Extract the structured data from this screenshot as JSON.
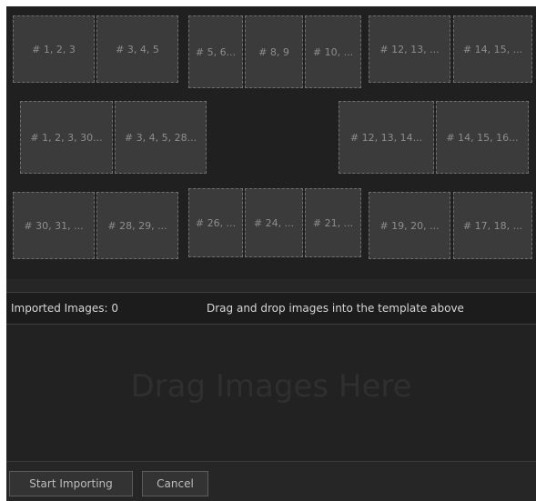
{
  "template": {
    "row1": [
      "# 1, 2, 3",
      "# 3, 4, 5",
      "# 5, 6...",
      "# 8, 9",
      "# 10, ...",
      "# 12, 13, ...",
      "# 14, 15, ..."
    ],
    "row2": [
      "# 1, 2, 3, 30...",
      "# 3, 4, 5, 28...",
      "# 12, 13, 14...",
      "# 14, 15, 16..."
    ],
    "row3": [
      "# 30, 31, ...",
      "# 28, 29, ...",
      "# 26, ...",
      "# 24, ...",
      "# 21, ...",
      "# 19, 20, ...",
      "# 17, 18, ..."
    ]
  },
  "info": {
    "imported_label": "Imported Images: 0",
    "hint": "Drag and drop images into the template above"
  },
  "drop_zone": {
    "label": "Drag Images Here"
  },
  "footer": {
    "start_label": "Start Importing",
    "cancel_label": "Cancel"
  }
}
